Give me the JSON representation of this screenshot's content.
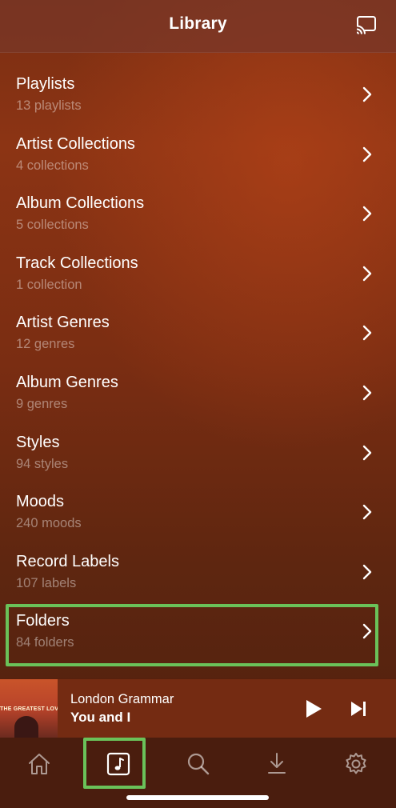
{
  "header": {
    "title": "Library",
    "cast_icon": "cast-icon"
  },
  "library": {
    "items": [
      {
        "title": "Playlists",
        "subtitle": "13 playlists"
      },
      {
        "title": "Artist Collections",
        "subtitle": "4 collections"
      },
      {
        "title": "Album Collections",
        "subtitle": "5 collections"
      },
      {
        "title": "Track Collections",
        "subtitle": "1 collection"
      },
      {
        "title": "Artist Genres",
        "subtitle": "12 genres"
      },
      {
        "title": "Album Genres",
        "subtitle": "9 genres"
      },
      {
        "title": "Styles",
        "subtitle": "94 styles"
      },
      {
        "title": "Moods",
        "subtitle": "240 moods"
      },
      {
        "title": "Record Labels",
        "subtitle": "107 labels"
      },
      {
        "title": "Folders",
        "subtitle": "84 folders"
      }
    ]
  },
  "now_playing": {
    "artist": "London Grammar",
    "song": "You and I",
    "album_art_text": "THE GREATEST LOVE"
  },
  "tabbar": {
    "tabs": [
      "home-icon",
      "music-note-icon",
      "search-icon",
      "download-icon",
      "gear-icon"
    ],
    "selected": "music-note-icon"
  },
  "colors": {
    "highlight": "#6ac259",
    "background": "#7a2e12"
  }
}
